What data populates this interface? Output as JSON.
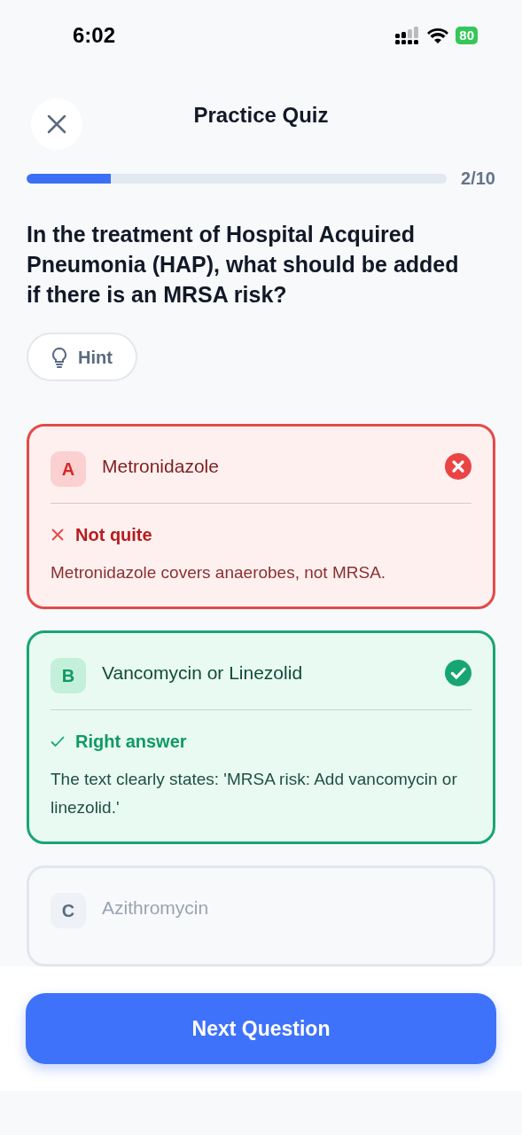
{
  "status_bar": {
    "time": "6:02",
    "battery": "80"
  },
  "header": {
    "title": "Practice Quiz"
  },
  "progress": {
    "level": 0.2,
    "label": "2/10"
  },
  "question": "In the treatment of Hospital Acquired Pneumonia (HAP), what should be added if there is an MRSA risk?",
  "hint_button": "Hint",
  "options": [
    {
      "letter": "A",
      "label": "Metronidazole",
      "kind": "wrong",
      "feedback_title": "Not quite",
      "feedback": "Metronidazole covers anaerobes, not MRSA."
    },
    {
      "letter": "B",
      "label": "Vancomycin or Linezolid",
      "kind": "correct",
      "feedback_title": "Right answer",
      "feedback": "The text clearly states: 'MRSA risk: Add vancomycin or linezolid.'"
    },
    {
      "letter": "C",
      "label": "Azithromycin",
      "kind": "neutral"
    }
  ],
  "next_button": "Next Question"
}
